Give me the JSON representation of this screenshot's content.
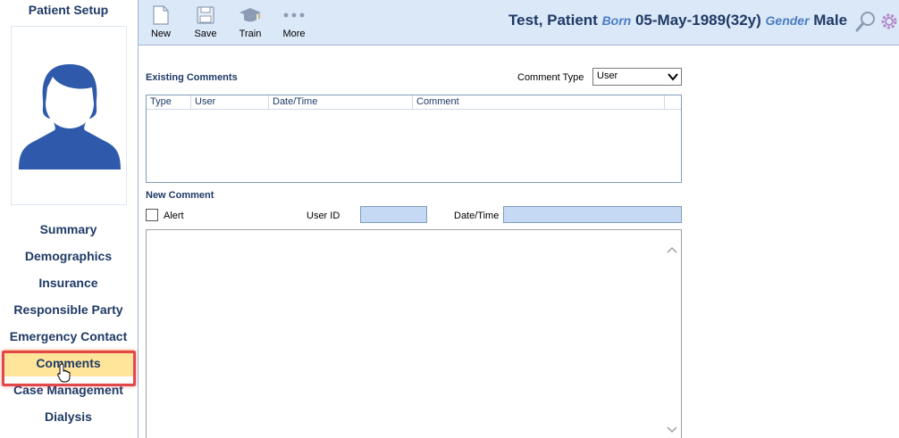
{
  "sidebar": {
    "title": "Patient Setup",
    "items": [
      {
        "label": "Summary"
      },
      {
        "label": "Demographics"
      },
      {
        "label": "Insurance"
      },
      {
        "label": "Responsible Party"
      },
      {
        "label": "Emergency Contact"
      },
      {
        "label": "Comments",
        "active": true
      },
      {
        "label": "Case Management"
      },
      {
        "label": "Dialysis"
      }
    ]
  },
  "toolbar": {
    "new_label": "New",
    "save_label": "Save",
    "train_label": "Train",
    "more_label": "More"
  },
  "patient": {
    "name": "Test, Patient",
    "born_label": "Born",
    "dob": "05-May-1989(32y)",
    "gender_label": "Gender",
    "gender": "Male"
  },
  "comments": {
    "existing_label": "Existing Comments",
    "type_label": "Comment Type",
    "type_value": "User",
    "columns": [
      "Type",
      "User",
      "Date/Time",
      "Comment"
    ],
    "new_label": "New Comment",
    "alert_label": "Alert",
    "userid_label": "User ID",
    "userid_value": "",
    "datetime_label": "Date/Time",
    "datetime_value": "",
    "comment_text": ""
  },
  "colors": {
    "accent": "#1f3a66",
    "toolbar_bg": "#dbe8f8",
    "active_item": "#ffe59a",
    "highlight": "#e2484a"
  }
}
